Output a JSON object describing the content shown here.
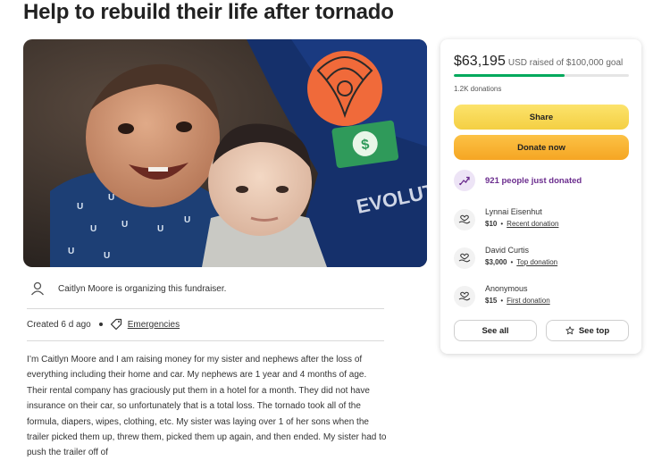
{
  "page": {
    "title": "Help to rebuild their life after tornado"
  },
  "hero": {
    "shirt_text": "EVOLUT"
  },
  "organizer": {
    "text": "Caitlyn Moore is organizing this fundraiser.",
    "icon": "user-icon"
  },
  "meta": {
    "created": "Created 6 d ago",
    "category": "Emergencies",
    "category_icon": "tag-icon"
  },
  "story": {
    "text": "I’m Caitlyn Moore and I am raising money for my sister and nephews after the loss of everything including their home and car.  My nephews are 1 year and 4 months of age. Their rental company has graciously put them in a hotel for a month. They did not have insurance on their car, so unfortunately that is a total loss. The tornado took all of the formula, diapers, wipes, clothing, etc. My sister was laying over 1 of her sons when the trailer picked them up, threw them, picked them up again, and then ended. My sister had to push the trailer off of"
  },
  "card": {
    "raised": "$63,195",
    "raised_suffix": "USD raised of $100,000 goal",
    "progress_fraction": 0.632,
    "donations": "1.2K donations",
    "share_label": "Share",
    "donate_label": "Donate now",
    "trending_text": "921 people just donated",
    "donors": [
      {
        "name": "Lynnai Eisenhut",
        "amount": "$10",
        "tag": "Recent donation"
      },
      {
        "name": "David Curtis",
        "amount": "$3,000",
        "tag": "Top donation"
      },
      {
        "name": "Anonymous",
        "amount": "$15",
        "tag": "First donation"
      }
    ],
    "see_all_label": "See all",
    "see_top_label": "See top"
  },
  "colors": {
    "progress": "#02a95c",
    "share": "#f4cf43",
    "donate": "#f5a623",
    "trending": "#6b2d8e"
  }
}
